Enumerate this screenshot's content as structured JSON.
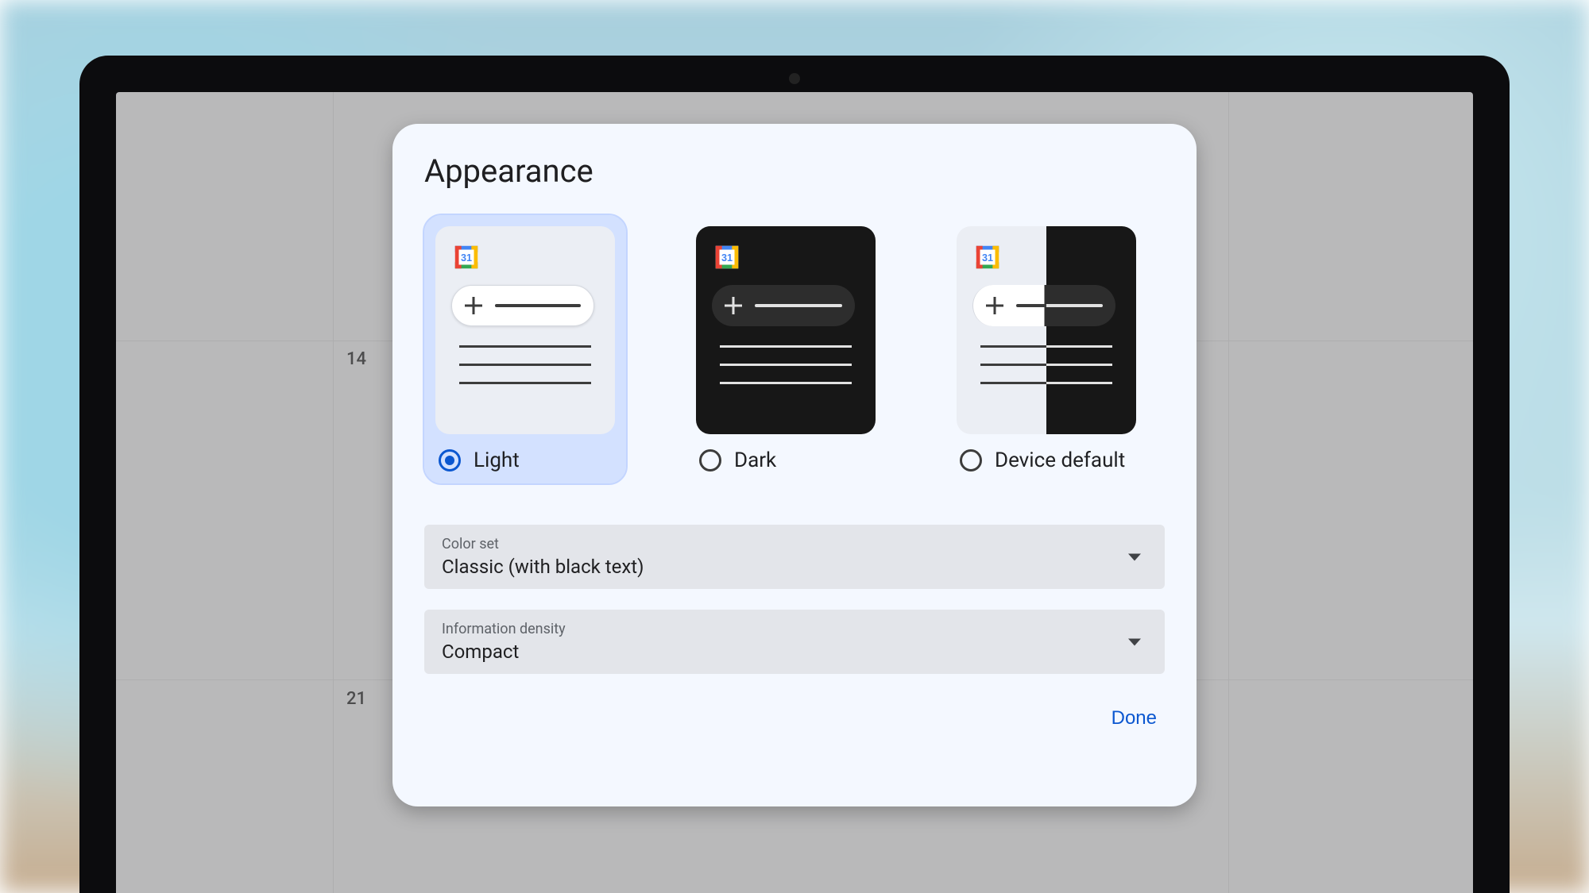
{
  "dialog": {
    "title": "Appearance",
    "done_label": "Done"
  },
  "themes": {
    "options": [
      {
        "label": "Light",
        "selected": true
      },
      {
        "label": "Dark",
        "selected": false
      },
      {
        "label": "Device default",
        "selected": false
      }
    ]
  },
  "selects": {
    "color_set": {
      "label": "Color set",
      "value": "Classic (with black text)"
    },
    "density": {
      "label": "Information density",
      "value": "Compact"
    }
  },
  "calendar_hint_dates": [
    "14",
    "21"
  ]
}
